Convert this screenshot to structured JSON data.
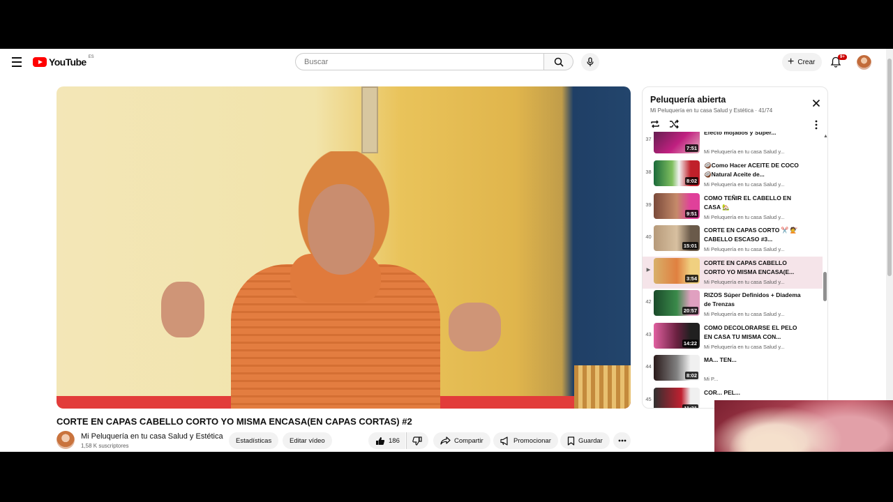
{
  "header": {
    "logo_text": "YouTube",
    "logo_country": "ES",
    "search_placeholder": "Buscar",
    "create_label": "Crear",
    "notification_count": "9+"
  },
  "video": {
    "title": "CORTE EN CAPAS CABELLO CORTO YO MISMA ENCASA(EN CAPAS CORTAS) #2",
    "channel": "Mi Peluquería en tu casa Salud y Estética",
    "subscribers": "1,58 K suscriptores",
    "stats_label": "Estadísticas",
    "edit_label": "Editar vídeo",
    "likes": "186",
    "share_label": "Compartir",
    "promote_label": "Promocionar",
    "save_label": "Guardar"
  },
  "playlist": {
    "title": "Peluquería abierta",
    "channel": "Mi Peluquería en tu casa Salud y Estética",
    "position": "41/74",
    "items": [
      {
        "index": "37",
        "title": "Efecto mojados y Super...",
        "channel": "Mi Peluquería en tu casa Salud y...",
        "duration": "7:51",
        "active": false
      },
      {
        "index": "38",
        "title": "🥥Como Hacer ACEITE DE COCO🥥Natural Aceite de...",
        "channel": "Mi Peluquería en tu casa Salud y...",
        "duration": "8:02",
        "active": false
      },
      {
        "index": "39",
        "title": "COMO TEÑIR EL CABELLO EN CASA 🏡",
        "channel": "Mi Peluquería en tu casa Salud y...",
        "duration": "9:51",
        "active": false
      },
      {
        "index": "40",
        "title": "CORTE EN CAPAS CORTO ✂️ 💇 CABELLO ESCASO #3...",
        "channel": "Mi Peluquería en tu casa Salud y...",
        "duration": "15:01",
        "active": false
      },
      {
        "index": "▶",
        "title": "CORTE EN CAPAS CABELLO CORTO YO MISMA ENCASA(E...",
        "channel": "Mi Peluquería en tu casa Salud y...",
        "duration": "3:54",
        "active": true
      },
      {
        "index": "42",
        "title": "RIZOS Súper Definidos + Diadema de Trenzas",
        "channel": "Mi Peluquería en tu casa Salud y...",
        "duration": "20:57",
        "active": false
      },
      {
        "index": "43",
        "title": "COMO DECOLORARSE EL PELO EN CASA TU MISMA CON...",
        "channel": "Mi Peluquería en tu casa Salud y...",
        "duration": "14:22",
        "active": false
      },
      {
        "index": "44",
        "title": "MA... TEN...",
        "channel": "Mi P...",
        "duration": "8:02",
        "active": false
      },
      {
        "index": "45",
        "title": "COR... PEL...",
        "channel": "",
        "duration": "11:21",
        "active": false
      }
    ]
  },
  "colors": {
    "brand_red": "#ff0000",
    "active_row": "#f5e4e9"
  }
}
